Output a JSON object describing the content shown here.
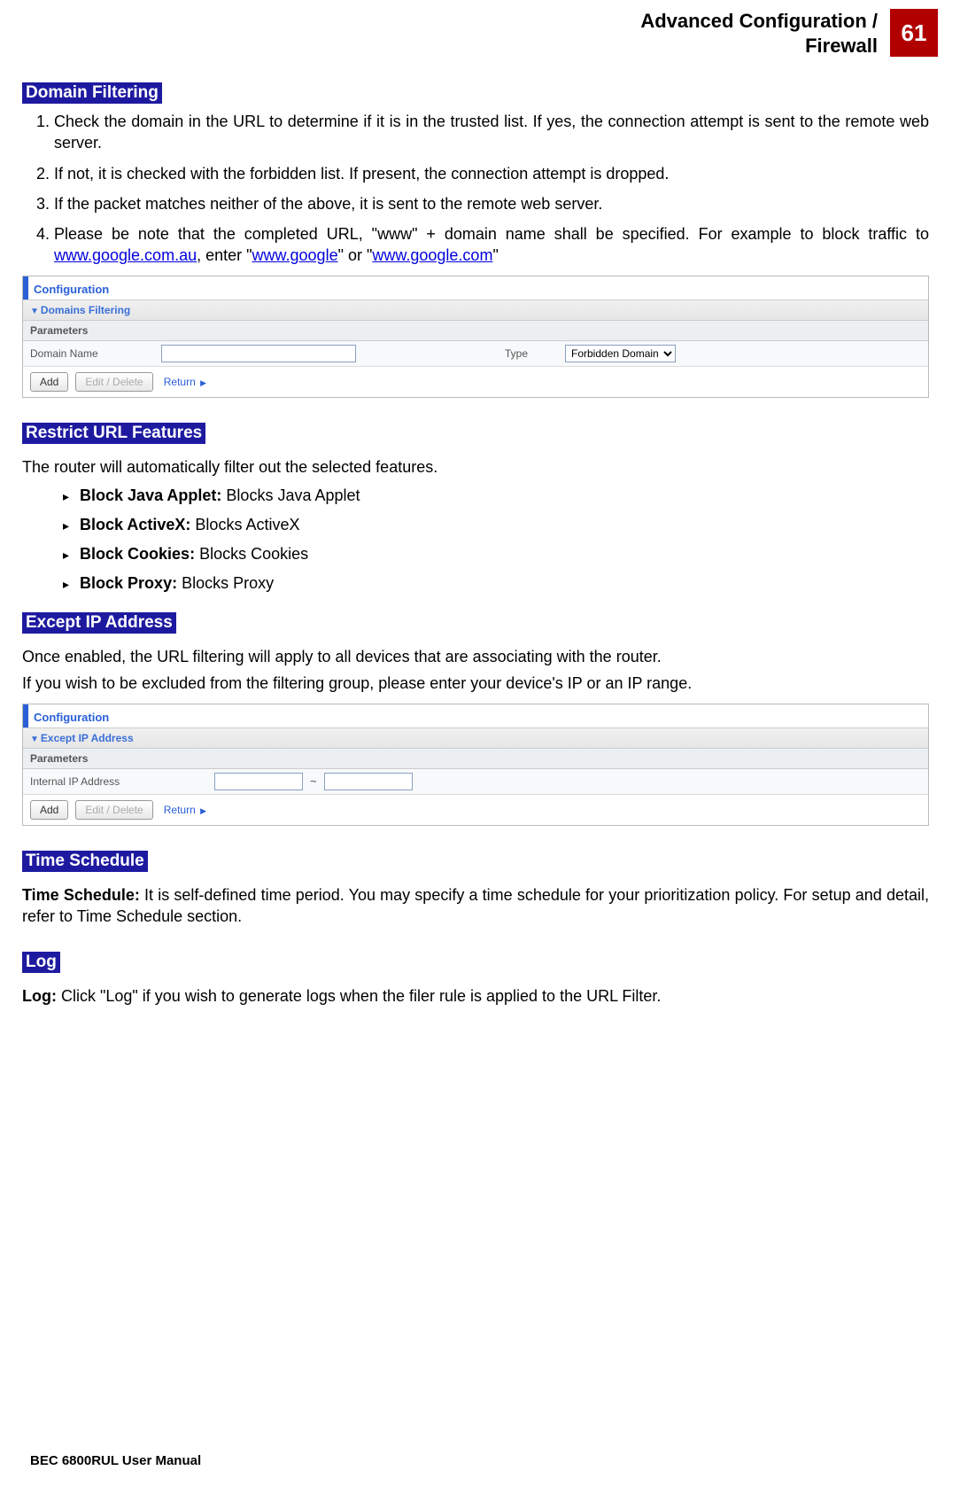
{
  "header": {
    "title_line1": "Advanced Configuration /",
    "title_line2": "Firewall",
    "page_number": "61"
  },
  "sections": {
    "domain_filtering": {
      "title": "Domain Filtering",
      "item1": "Check the domain in the URL to determine if it is in the trusted list. If yes, the connection attempt is sent to the remote web server.",
      "item2": "If not, it is checked with the forbidden list. If present, the connection attempt is dropped.",
      "item3": "If the packet matches neither of the above, it is sent to the remote web server.",
      "item4_pre": "Please be note that the completed URL, \"www\" + domain name shall be specified. For example to block traffic to ",
      "item4_link1": "www.google.com.au",
      "item4_mid": ", enter \"",
      "item4_link2": "www.google",
      "item4_mid2": "\" or \"",
      "item4_link3": "www.google.com",
      "item4_end": "\""
    },
    "restrict_url": {
      "title": "Restrict URL Features",
      "intro": "The router will automatically filter out the selected features.",
      "b1_label": "Block Java Applet:",
      "b1_desc": " Blocks Java Applet",
      "b2_label": "Block ActiveX:",
      "b2_desc": " Blocks ActiveX",
      "b3_label": "Block Cookies:",
      "b3_desc": " Blocks Cookies",
      "b4_label": "Block Proxy:",
      "b4_desc": " Blocks Proxy"
    },
    "except_ip": {
      "title": "Except IP Address",
      "p1": "Once enabled, the URL filtering will apply to all devices that are associating with the router.",
      "p2": "If you wish to be excluded from the filtering group, please enter your device's IP or an IP range."
    },
    "time_schedule": {
      "title": "Time Schedule",
      "label": "Time Schedule:",
      "desc": " It is self-defined time period. You may specify a time schedule for your prioritization policy. For setup and detail, refer to Time Schedule section."
    },
    "log": {
      "title": "Log",
      "label": "Log:",
      "desc": " Click \"Log\" if you wish to generate logs when the filer rule is applied to the URL Filter."
    }
  },
  "panel1": {
    "config": "Configuration",
    "subhead": "Domains Filtering",
    "params": "Parameters",
    "domain_name": "Domain Name",
    "type": "Type",
    "type_value": "Forbidden Domain",
    "add": "Add",
    "edit": "Edit / Delete",
    "return": "Return"
  },
  "panel2": {
    "config": "Configuration",
    "subhead": "Except IP Address",
    "params": "Parameters",
    "internal_ip": "Internal IP Address",
    "tilde": "~",
    "add": "Add",
    "edit": "Edit / Delete",
    "return": "Return"
  },
  "footer": "BEC 6800RUL User Manual"
}
